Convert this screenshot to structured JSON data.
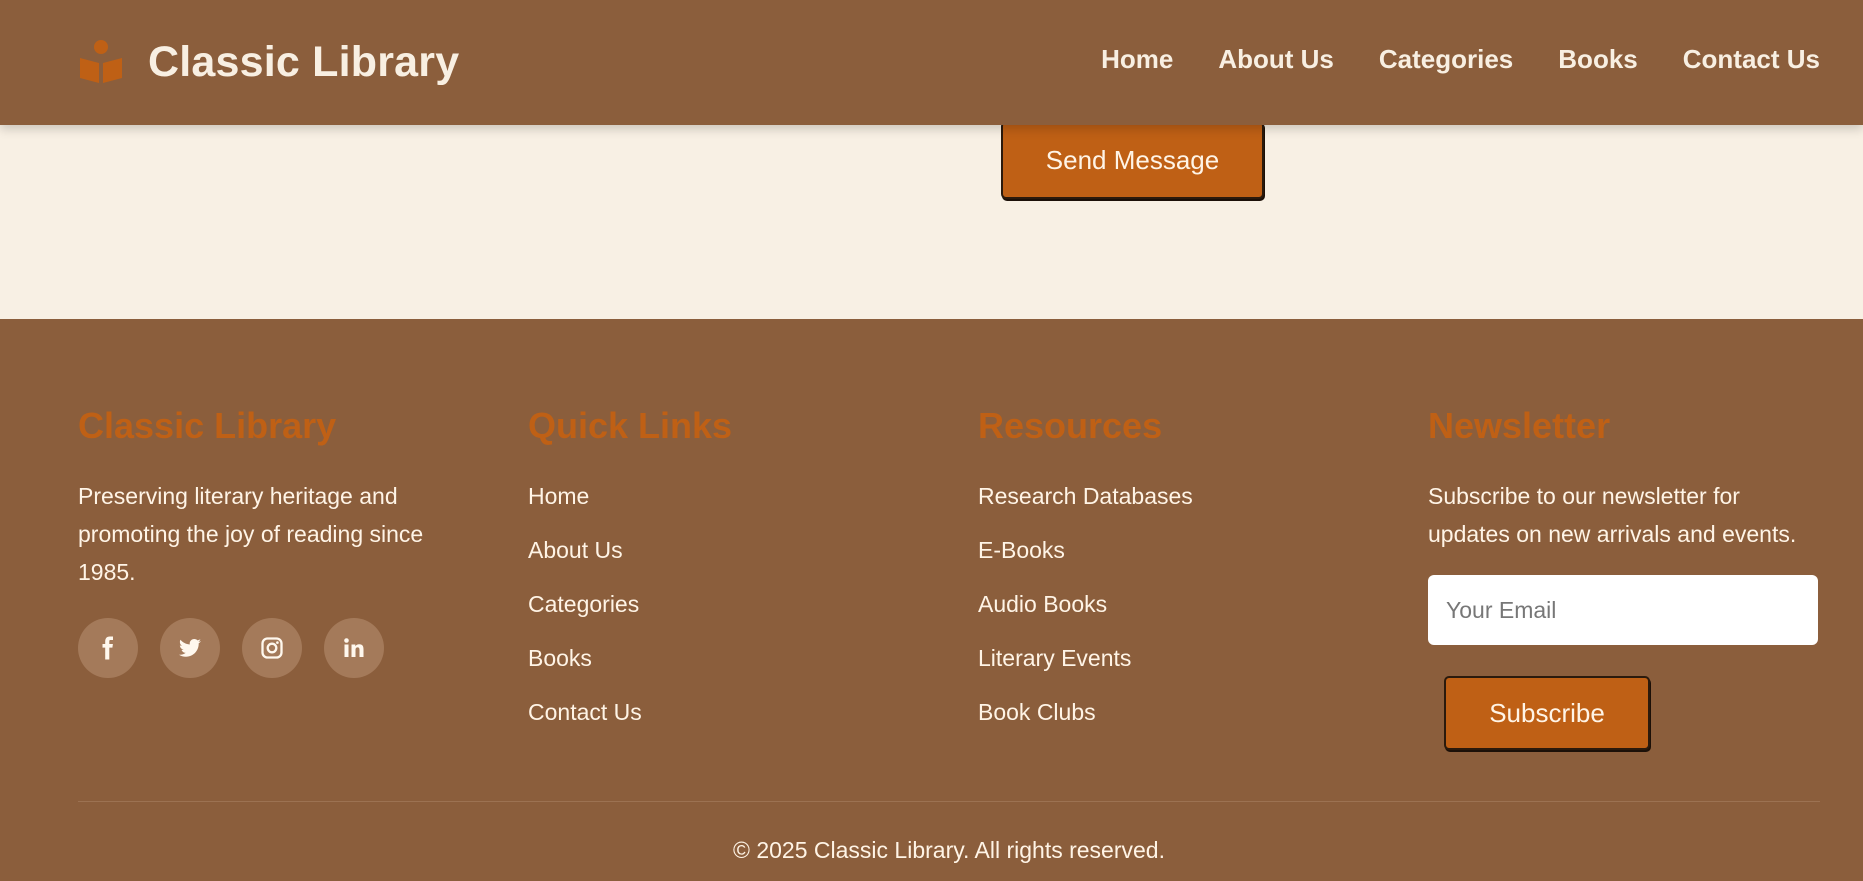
{
  "header": {
    "brand_name": "Classic Library",
    "brand_icon": "book-reader-icon",
    "nav": [
      {
        "label": "Home"
      },
      {
        "label": "About Us"
      },
      {
        "label": "Categories"
      },
      {
        "label": "Books"
      },
      {
        "label": "Contact Us"
      }
    ]
  },
  "contact": {
    "send_label": "Send Message"
  },
  "footer": {
    "about": {
      "title": "Classic Library",
      "text": "Preserving literary heritage and promoting the joy of reading since 1985.",
      "socials": [
        "facebook-icon",
        "twitter-icon",
        "instagram-icon",
        "linkedin-icon"
      ]
    },
    "quick_links": {
      "title": "Quick Links",
      "items": [
        "Home",
        "About Us",
        "Categories",
        "Books",
        "Contact Us"
      ]
    },
    "resources": {
      "title": "Resources",
      "items": [
        "Research Databases",
        "E-Books",
        "Audio Books",
        "Literary Events",
        "Book Clubs"
      ]
    },
    "newsletter": {
      "title": "Newsletter",
      "text": "Subscribe to our newsletter for updates on new arrivals and events.",
      "email_placeholder": "Your Email",
      "email_value": "",
      "subscribe_label": "Subscribe"
    },
    "copyright": "© 2025 Classic Library. All rights reserved."
  },
  "colors": {
    "primary_brown": "#8b5e3c",
    "accent_orange": "#bf6015",
    "cream": "#f8f0e4",
    "light_text": "#fff4e6"
  }
}
